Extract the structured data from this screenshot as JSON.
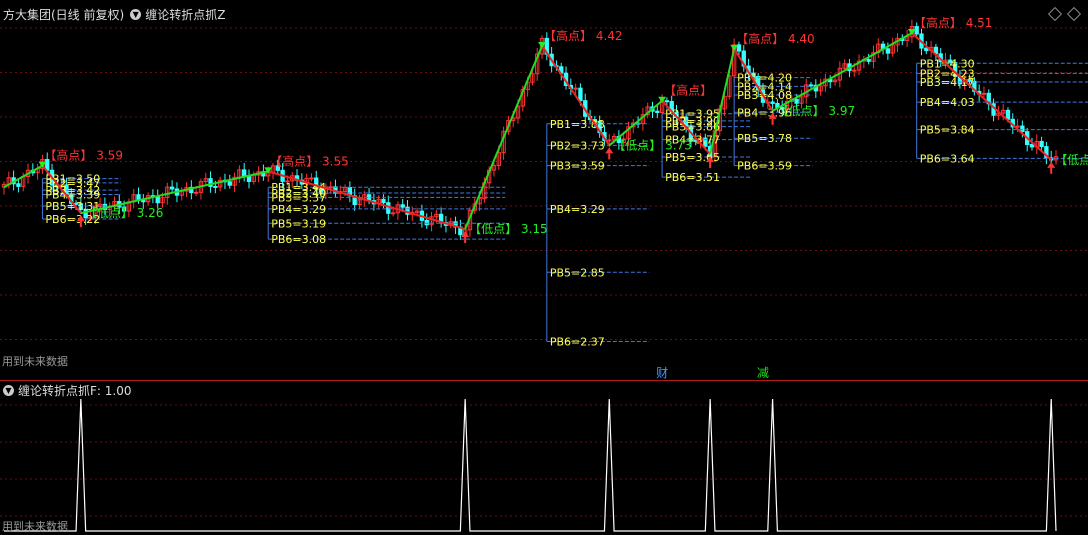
{
  "header": {
    "stock_name": "方大集团(日线 前复权)",
    "indicator_name": "缠论转折点抓Z",
    "future_data_note": "用到未来数据"
  },
  "sub_header": {
    "indicator_name": "缠论转折点抓F",
    "value": ": 1.00",
    "future_data_note": "用到未来数据"
  },
  "colors": {
    "up": "#ff3333",
    "down": "#33ffff",
    "green_line": "#22dd22",
    "red_line": "#ee2222",
    "pb_line": "#4477dd",
    "pb_text": "#ffff55",
    "high_text": "#ff3333",
    "low_text": "#22ee22",
    "grid": "#661111",
    "sub_line": "#ffffff"
  },
  "chart_data": [
    {
      "type": "candlestick",
      "ylim": [
        2.2,
        4.6
      ],
      "x_count": 220,
      "grid": true,
      "pivots": [
        {
          "x": 0,
          "price": 3.44
        },
        {
          "x": 8,
          "price": 3.59,
          "kind": "high",
          "label": "【高点】",
          "value_text": "3.59"
        },
        {
          "x": 16,
          "price": 3.26,
          "kind": "low",
          "label": "【低点】",
          "value_text": "3.26"
        },
        {
          "x": 55,
          "price": 3.55,
          "kind": "high",
          "label": "【高点】",
          "value_text": "3.55"
        },
        {
          "x": 96,
          "price": 3.15,
          "kind": "low",
          "label": "【低点】",
          "value_text": "3.15"
        },
        {
          "x": 112,
          "price": 4.42,
          "kind": "high",
          "label": "【高点】",
          "value_text": "4.42"
        },
        {
          "x": 126,
          "price": 3.73,
          "kind": "low",
          "label": "【低点】",
          "value_text": "3.73"
        },
        {
          "x": 137,
          "price": 4.04,
          "kind": "high",
          "label": "【高点】",
          "value_text": ""
        },
        {
          "x": 147,
          "price": 3.67,
          "kind": "low",
          "label": "",
          "value_text": ""
        },
        {
          "x": 152,
          "price": 4.4,
          "kind": "high",
          "label": "【高点】",
          "value_text": "4.40"
        },
        {
          "x": 160,
          "price": 3.97,
          "kind": "low",
          "label": "【低点】",
          "value_text": "3.97"
        },
        {
          "x": 189,
          "price": 4.51,
          "kind": "high",
          "label": "【高点】",
          "value_text": "4.51"
        },
        {
          "x": 218,
          "price": 3.63,
          "kind": "low",
          "label": "【低点】",
          "value_text": ""
        }
      ],
      "pb_groups": [
        {
          "x": 8,
          "x_end": 16,
          "levels": [
            {
              "label": "PB1=3.50",
              "price": 3.5
            },
            {
              "label": "PB2=3.47",
              "price": 3.47
            },
            {
              "label": "PB3=3.42",
              "price": 3.42
            },
            {
              "label": "PB4=3.39",
              "price": 3.39
            },
            {
              "label": "PB5=3.31",
              "price": 3.31
            },
            {
              "label": "PB6=3.22",
              "price": 3.22
            }
          ]
        },
        {
          "x": 55,
          "x_end": 96,
          "levels": [
            {
              "label": "PB1=3.44",
              "price": 3.44
            },
            {
              "label": "PB2=3.40",
              "price": 3.4
            },
            {
              "label": "PB3=3.37",
              "price": 3.37
            },
            {
              "label": "PB4=3.29",
              "price": 3.29
            },
            {
              "label": "PB5=3.19",
              "price": 3.19
            },
            {
              "label": "PB6=3.08",
              "price": 3.08
            }
          ]
        },
        {
          "x": 113,
          "x_end": 126,
          "levels": [
            {
              "label": "PB1=3.88",
              "price": 3.88
            },
            {
              "label": "PB2=3.73",
              "price": 3.73
            },
            {
              "label": "PB3=3.59",
              "price": 3.59
            },
            {
              "label": "PB4=3.29",
              "price": 3.29
            },
            {
              "label": "PB5=2.85",
              "price": 2.85
            },
            {
              "label": "PB6=2.37",
              "price": 2.37
            }
          ]
        },
        {
          "x": 137,
          "x_end": 147,
          "levels": [
            {
              "label": "PB1=3.95",
              "price": 3.95
            },
            {
              "label": "PB2=3.90",
              "price": 3.9
            },
            {
              "label": "PB3=3.86",
              "price": 3.86
            },
            {
              "label": "PB4=3.77",
              "price": 3.77
            },
            {
              "label": "PB5=3.65",
              "price": 3.65
            },
            {
              "label": "PB6=3.51",
              "price": 3.51
            }
          ]
        },
        {
          "x": 152,
          "x_end": 160,
          "levels": [
            {
              "label": "PB1=4.20",
              "price": 4.2
            },
            {
              "label": "PB2=4.14",
              "price": 4.14
            },
            {
              "label": "PB3=4.08",
              "price": 4.08
            },
            {
              "label": "PB4=3.96",
              "price": 3.96
            },
            {
              "label": "PB5=3.78",
              "price": 3.78
            },
            {
              "label": "PB6=3.59",
              "price": 3.59
            }
          ]
        },
        {
          "x": 190,
          "x_end": 218,
          "levels": [
            {
              "label": "PB1=4.30",
              "price": 4.3
            },
            {
              "label": "PB2=4.23",
              "price": 4.23
            },
            {
              "label": "PB3=4.17",
              "price": 4.17
            },
            {
              "label": "PB4=4.03",
              "price": 4.03
            },
            {
              "label": "PB5=3.84",
              "price": 3.84
            },
            {
              "label": "PB6=3.64",
              "price": 3.64
            }
          ]
        }
      ],
      "markers": [
        {
          "x": 137,
          "text": "财",
          "color": "#4499ff"
        },
        {
          "x": 158,
          "text": "减",
          "color": "#22dd22"
        }
      ]
    },
    {
      "type": "line",
      "ylim": [
        0,
        1
      ],
      "spikes_at_x": [
        16,
        96,
        126,
        147,
        160,
        218
      ],
      "baseline": 0,
      "peak": 1
    }
  ]
}
